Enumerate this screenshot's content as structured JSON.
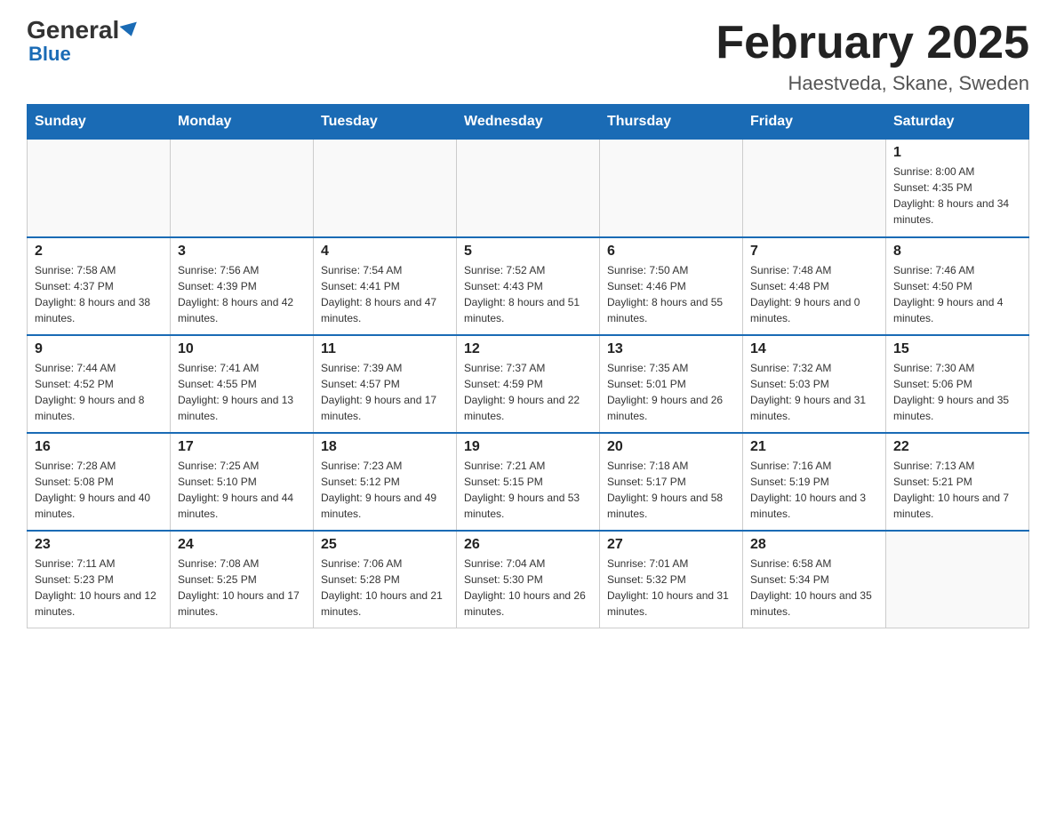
{
  "logo": {
    "general": "General",
    "blue": "Blue"
  },
  "title": "February 2025",
  "location": "Haestveda, Skane, Sweden",
  "days_of_week": [
    "Sunday",
    "Monday",
    "Tuesday",
    "Wednesday",
    "Thursday",
    "Friday",
    "Saturday"
  ],
  "weeks": [
    [
      {
        "day": "",
        "info": ""
      },
      {
        "day": "",
        "info": ""
      },
      {
        "day": "",
        "info": ""
      },
      {
        "day": "",
        "info": ""
      },
      {
        "day": "",
        "info": ""
      },
      {
        "day": "",
        "info": ""
      },
      {
        "day": "1",
        "info": "Sunrise: 8:00 AM\nSunset: 4:35 PM\nDaylight: 8 hours and 34 minutes."
      }
    ],
    [
      {
        "day": "2",
        "info": "Sunrise: 7:58 AM\nSunset: 4:37 PM\nDaylight: 8 hours and 38 minutes."
      },
      {
        "day": "3",
        "info": "Sunrise: 7:56 AM\nSunset: 4:39 PM\nDaylight: 8 hours and 42 minutes."
      },
      {
        "day": "4",
        "info": "Sunrise: 7:54 AM\nSunset: 4:41 PM\nDaylight: 8 hours and 47 minutes."
      },
      {
        "day": "5",
        "info": "Sunrise: 7:52 AM\nSunset: 4:43 PM\nDaylight: 8 hours and 51 minutes."
      },
      {
        "day": "6",
        "info": "Sunrise: 7:50 AM\nSunset: 4:46 PM\nDaylight: 8 hours and 55 minutes."
      },
      {
        "day": "7",
        "info": "Sunrise: 7:48 AM\nSunset: 4:48 PM\nDaylight: 9 hours and 0 minutes."
      },
      {
        "day": "8",
        "info": "Sunrise: 7:46 AM\nSunset: 4:50 PM\nDaylight: 9 hours and 4 minutes."
      }
    ],
    [
      {
        "day": "9",
        "info": "Sunrise: 7:44 AM\nSunset: 4:52 PM\nDaylight: 9 hours and 8 minutes."
      },
      {
        "day": "10",
        "info": "Sunrise: 7:41 AM\nSunset: 4:55 PM\nDaylight: 9 hours and 13 minutes."
      },
      {
        "day": "11",
        "info": "Sunrise: 7:39 AM\nSunset: 4:57 PM\nDaylight: 9 hours and 17 minutes."
      },
      {
        "day": "12",
        "info": "Sunrise: 7:37 AM\nSunset: 4:59 PM\nDaylight: 9 hours and 22 minutes."
      },
      {
        "day": "13",
        "info": "Sunrise: 7:35 AM\nSunset: 5:01 PM\nDaylight: 9 hours and 26 minutes."
      },
      {
        "day": "14",
        "info": "Sunrise: 7:32 AM\nSunset: 5:03 PM\nDaylight: 9 hours and 31 minutes."
      },
      {
        "day": "15",
        "info": "Sunrise: 7:30 AM\nSunset: 5:06 PM\nDaylight: 9 hours and 35 minutes."
      }
    ],
    [
      {
        "day": "16",
        "info": "Sunrise: 7:28 AM\nSunset: 5:08 PM\nDaylight: 9 hours and 40 minutes."
      },
      {
        "day": "17",
        "info": "Sunrise: 7:25 AM\nSunset: 5:10 PM\nDaylight: 9 hours and 44 minutes."
      },
      {
        "day": "18",
        "info": "Sunrise: 7:23 AM\nSunset: 5:12 PM\nDaylight: 9 hours and 49 minutes."
      },
      {
        "day": "19",
        "info": "Sunrise: 7:21 AM\nSunset: 5:15 PM\nDaylight: 9 hours and 53 minutes."
      },
      {
        "day": "20",
        "info": "Sunrise: 7:18 AM\nSunset: 5:17 PM\nDaylight: 9 hours and 58 minutes."
      },
      {
        "day": "21",
        "info": "Sunrise: 7:16 AM\nSunset: 5:19 PM\nDaylight: 10 hours and 3 minutes."
      },
      {
        "day": "22",
        "info": "Sunrise: 7:13 AM\nSunset: 5:21 PM\nDaylight: 10 hours and 7 minutes."
      }
    ],
    [
      {
        "day": "23",
        "info": "Sunrise: 7:11 AM\nSunset: 5:23 PM\nDaylight: 10 hours and 12 minutes."
      },
      {
        "day": "24",
        "info": "Sunrise: 7:08 AM\nSunset: 5:25 PM\nDaylight: 10 hours and 17 minutes."
      },
      {
        "day": "25",
        "info": "Sunrise: 7:06 AM\nSunset: 5:28 PM\nDaylight: 10 hours and 21 minutes."
      },
      {
        "day": "26",
        "info": "Sunrise: 7:04 AM\nSunset: 5:30 PM\nDaylight: 10 hours and 26 minutes."
      },
      {
        "day": "27",
        "info": "Sunrise: 7:01 AM\nSunset: 5:32 PM\nDaylight: 10 hours and 31 minutes."
      },
      {
        "day": "28",
        "info": "Sunrise: 6:58 AM\nSunset: 5:34 PM\nDaylight: 10 hours and 35 minutes."
      },
      {
        "day": "",
        "info": ""
      }
    ]
  ]
}
